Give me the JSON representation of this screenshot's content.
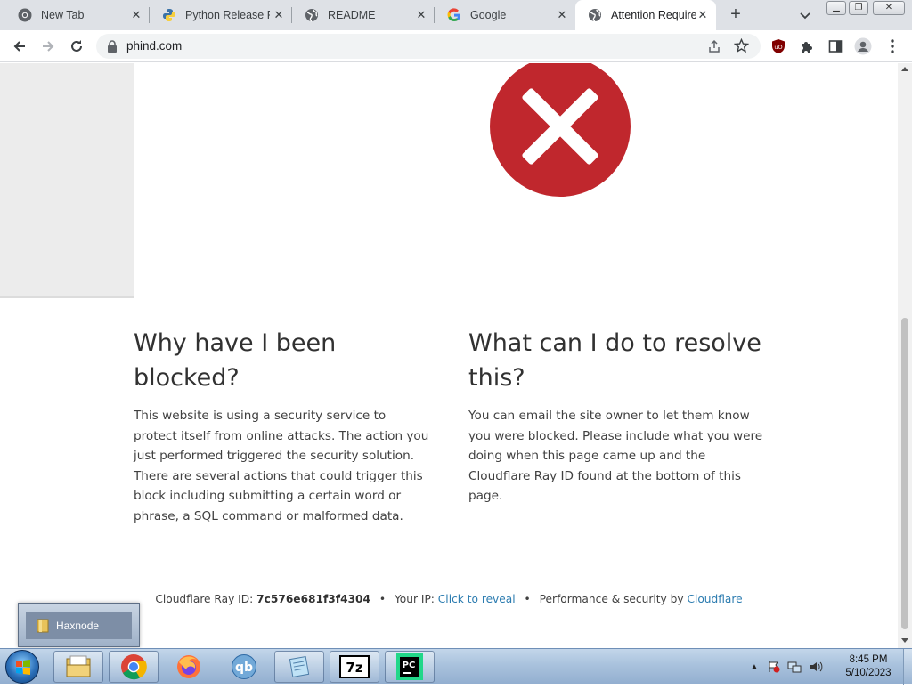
{
  "browser": {
    "tabs": [
      {
        "title": "New Tab",
        "icon": "chrome-icon",
        "active": false
      },
      {
        "title": "Python Release Py",
        "icon": "python-icon",
        "active": false
      },
      {
        "title": "README",
        "icon": "globe-icon",
        "active": false
      },
      {
        "title": "Google",
        "icon": "google-icon",
        "active": false
      },
      {
        "title": "Attention Required",
        "icon": "globe-icon",
        "active": true
      }
    ],
    "new_tab_label": "+",
    "url": "phind.com"
  },
  "page": {
    "left_heading": "Why have I been blocked?",
    "left_text": "This website is using a security service to protect itself from online attacks. The action you just performed triggered the security solution. There are several actions that could trigger this block including submitting a certain word or phrase, a SQL command or malformed data.",
    "right_heading": "What can I do to resolve this?",
    "right_text": "You can email the site owner to let them know you were blocked. Please include what you were doing when this page came up and the Cloudflare Ray ID found at the bottom of this page.",
    "footer": {
      "ray_label": "Cloudflare Ray ID:",
      "ray_id": "7c576e681f3f4304",
      "ip_label": "Your IP:",
      "ip_link": "Click to reveal",
      "perf_label": "Performance & security by",
      "perf_link": "Cloudflare",
      "separator": "•"
    }
  },
  "taskbar": {
    "popup_label": "Haxnode",
    "apps": [
      "file-explorer",
      "chrome",
      "firefox",
      "qbittorrent",
      "notepad",
      "7zip",
      "pycharm"
    ],
    "sevenzip_label": "7z",
    "pycharm_label": "PC",
    "qb_label": "qb",
    "time": "8:45 PM",
    "date": "5/10/2023"
  },
  "colors": {
    "error_red": "#c0272d",
    "link_blue": "#2c7cb0"
  }
}
